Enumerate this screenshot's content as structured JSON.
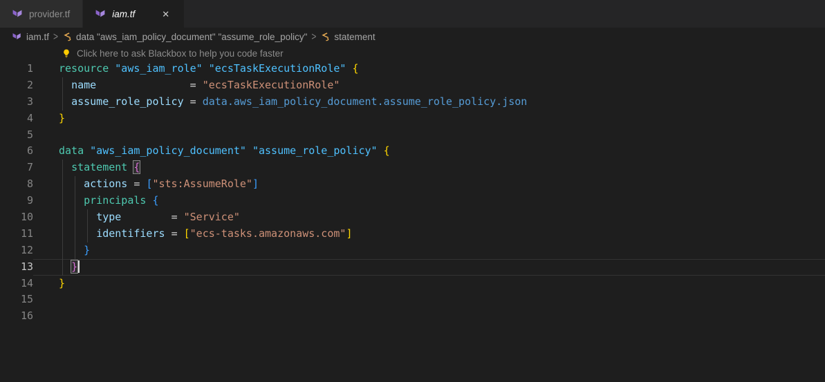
{
  "tabs": [
    {
      "label": "provider.tf",
      "active": false
    },
    {
      "label": "iam.tf",
      "active": true,
      "close_icon": "✕"
    }
  ],
  "breadcrumb": {
    "separator": ">",
    "file": "iam.tf",
    "items": [
      {
        "label": "data \"aws_iam_policy_document\" \"assume_role_policy\""
      },
      {
        "label": "statement"
      }
    ]
  },
  "hint": {
    "text": "Click here to ask Blackbox to help you code faster"
  },
  "colors": {
    "editor_bg": "#1e1e1e",
    "tabbar_bg": "#252526",
    "inactive_tab_bg": "#2d2d2d",
    "keyword": "#4ec9b0",
    "block_label": "#4fc1ff",
    "attribute": "#9cdcfe",
    "string": "#ce9178",
    "expression": "#569cd6",
    "bracket_1": "#ffd700",
    "bracket_2": "#d670d6",
    "bracket_3": "#3b9eff",
    "line_number": "#858585",
    "active_line_number": "#c6c6c6",
    "terraform_icon": "#8a63c9",
    "symbol_icon": "#e8ab53",
    "lightbulb": "#ffcc00"
  },
  "editor": {
    "lines": [
      {
        "num": 1,
        "guides": [],
        "tokens": [
          [
            "kw",
            "resource"
          ],
          [
            "pl",
            " "
          ],
          [
            "lb",
            "\"aws_iam_role\""
          ],
          [
            "pl",
            " "
          ],
          [
            "lb",
            "\"ecsTaskExecutionRole\""
          ],
          [
            "pl",
            " "
          ],
          [
            "b1",
            "{"
          ]
        ]
      },
      {
        "num": 2,
        "guides": [
          0
        ],
        "tokens": [
          [
            "pl",
            "  "
          ],
          [
            "pr",
            "name"
          ],
          [
            "pl",
            "               "
          ],
          [
            "op",
            "="
          ],
          [
            "pl",
            " "
          ],
          [
            "st",
            "\"ecsTaskExecutionRole\""
          ]
        ]
      },
      {
        "num": 3,
        "guides": [
          0
        ],
        "tokens": [
          [
            "pl",
            "  "
          ],
          [
            "pr",
            "assume_role_policy"
          ],
          [
            "pl",
            " "
          ],
          [
            "op",
            "="
          ],
          [
            "pl",
            " "
          ],
          [
            "ex",
            "data.aws_iam_policy_document.assume_role_policy.json"
          ]
        ]
      },
      {
        "num": 4,
        "guides": [],
        "tokens": [
          [
            "b1",
            "}"
          ]
        ]
      },
      {
        "num": 5,
        "guides": [],
        "tokens": []
      },
      {
        "num": 6,
        "guides": [],
        "tokens": [
          [
            "kw",
            "data"
          ],
          [
            "pl",
            " "
          ],
          [
            "lb",
            "\"aws_iam_policy_document\""
          ],
          [
            "pl",
            " "
          ],
          [
            "lb",
            "\"assume_role_policy\""
          ],
          [
            "pl",
            " "
          ],
          [
            "b1",
            "{"
          ]
        ]
      },
      {
        "num": 7,
        "guides": [
          0
        ],
        "tokens": [
          [
            "pl",
            "  "
          ],
          [
            "kw",
            "statement"
          ],
          [
            "pl",
            " "
          ],
          [
            "b2",
            "{",
            "m"
          ]
        ]
      },
      {
        "num": 8,
        "guides": [
          0,
          1
        ],
        "tokens": [
          [
            "pl",
            "    "
          ],
          [
            "pr",
            "actions"
          ],
          [
            "pl",
            " "
          ],
          [
            "op",
            "="
          ],
          [
            "pl",
            " "
          ],
          [
            "b3",
            "["
          ],
          [
            "st",
            "\"sts:AssumeRole\""
          ],
          [
            "b3",
            "]"
          ]
        ]
      },
      {
        "num": 9,
        "guides": [
          0,
          1
        ],
        "tokens": [
          [
            "pl",
            "    "
          ],
          [
            "kw",
            "principals"
          ],
          [
            "pl",
            " "
          ],
          [
            "b3",
            "{"
          ]
        ]
      },
      {
        "num": 10,
        "guides": [
          0,
          1,
          2
        ],
        "tokens": [
          [
            "pl",
            "      "
          ],
          [
            "pr",
            "type"
          ],
          [
            "pl",
            "        "
          ],
          [
            "op",
            "="
          ],
          [
            "pl",
            " "
          ],
          [
            "st",
            "\"Service\""
          ]
        ]
      },
      {
        "num": 11,
        "guides": [
          0,
          1,
          2
        ],
        "tokens": [
          [
            "pl",
            "      "
          ],
          [
            "pr",
            "identifiers"
          ],
          [
            "pl",
            " "
          ],
          [
            "op",
            "="
          ],
          [
            "pl",
            " "
          ],
          [
            "b1",
            "["
          ],
          [
            "st",
            "\"ecs-tasks.amazonaws.com\""
          ],
          [
            "b1",
            "]"
          ]
        ]
      },
      {
        "num": 12,
        "guides": [
          0,
          1
        ],
        "tokens": [
          [
            "pl",
            "    "
          ],
          [
            "b3",
            "}"
          ]
        ]
      },
      {
        "num": 13,
        "guides": [
          0
        ],
        "current": true,
        "tokens": [
          [
            "pl",
            "  "
          ],
          [
            "b2",
            "}",
            "mc"
          ]
        ]
      },
      {
        "num": 14,
        "guides": [],
        "tokens": [
          [
            "b1",
            "}"
          ]
        ]
      },
      {
        "num": 15,
        "guides": [],
        "tokens": []
      },
      {
        "num": 16,
        "guides": [],
        "tokens": []
      }
    ]
  }
}
